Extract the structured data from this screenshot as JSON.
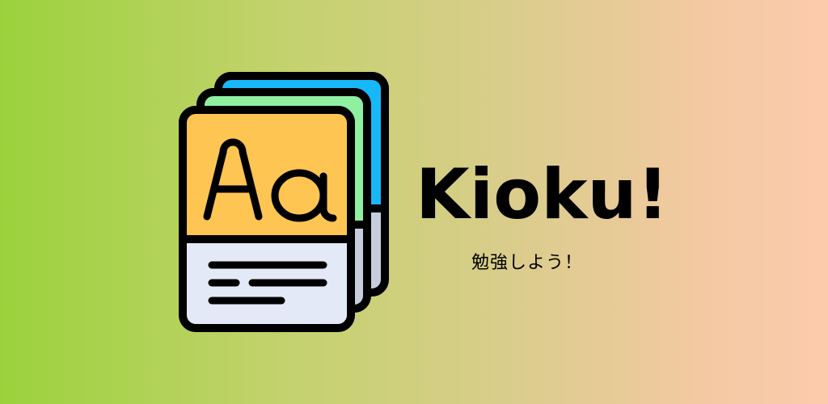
{
  "banner": {
    "app_name": "Kioku!",
    "tagline": "勉強しよう！",
    "logo": {
      "icon": "flashcard-deck-icon",
      "card_glyph": "Aa",
      "colors": {
        "front_card_top": "#ffc552",
        "middle_card_top": "#8ef0a0",
        "back_card_top": "#18b8f8",
        "card_body": "#e4e9f7",
        "back_card_body": "#c6cede",
        "outline": "#000000"
      }
    },
    "colors": {
      "gradient_left": "#9bd23c",
      "gradient_right": "#fccbac",
      "text": "#000000"
    }
  }
}
